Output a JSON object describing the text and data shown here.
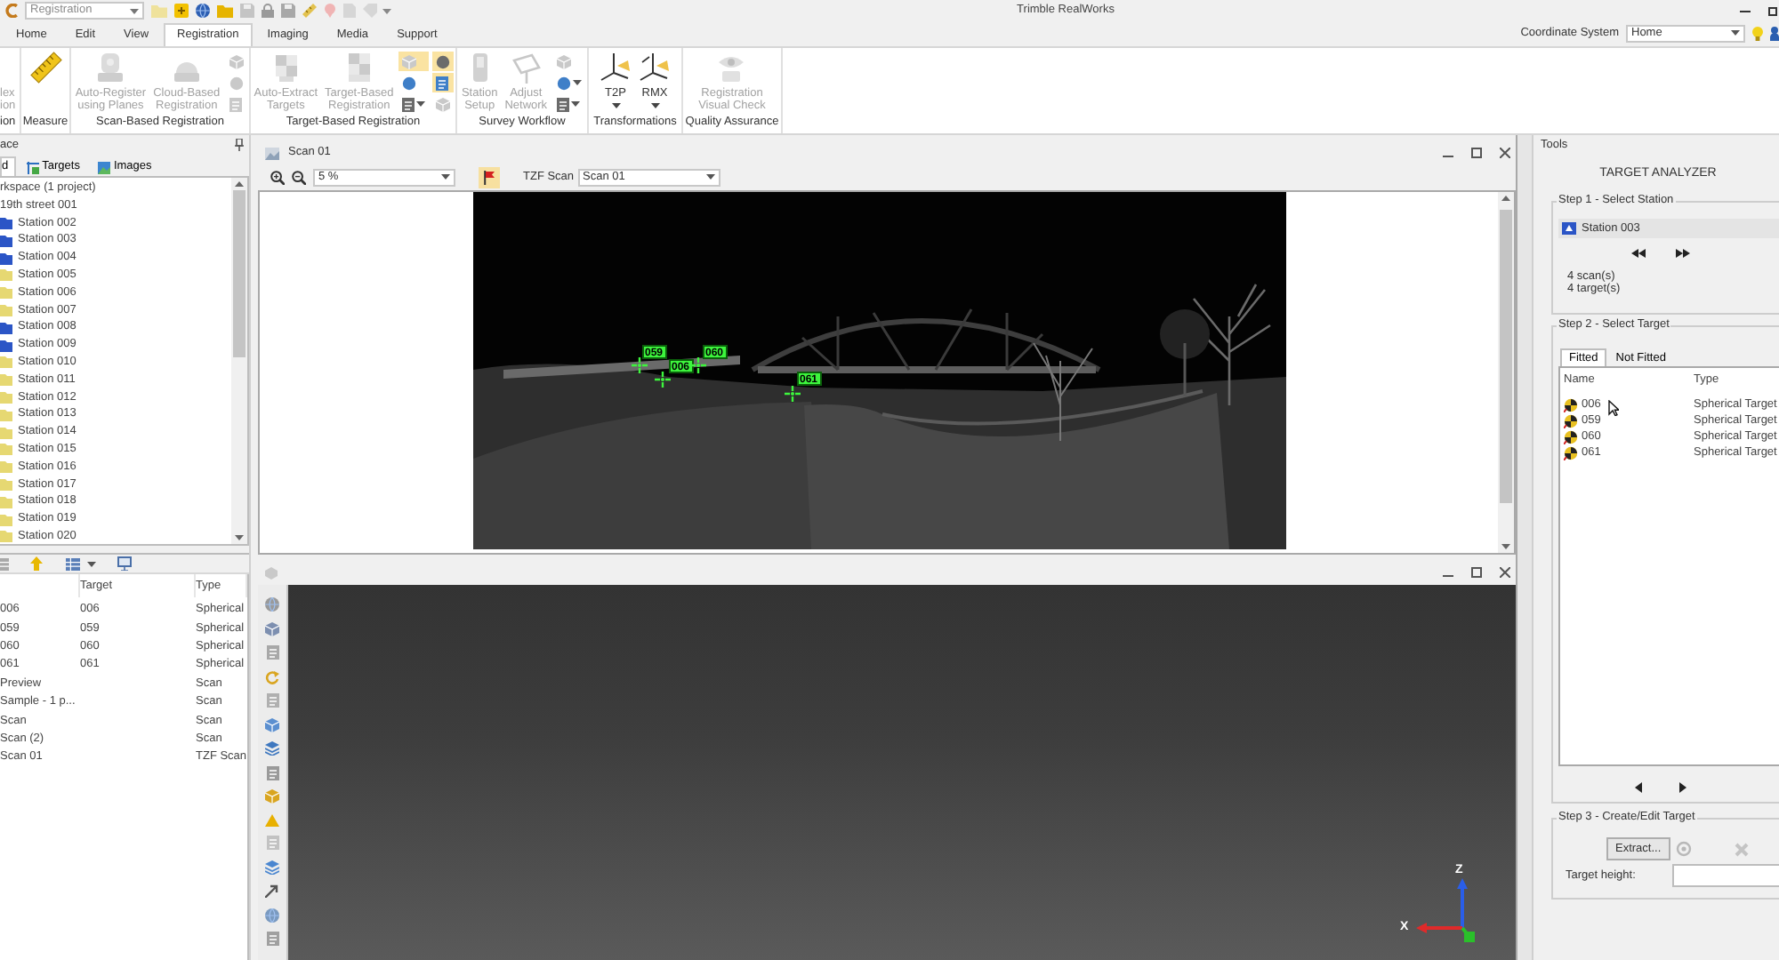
{
  "app": {
    "mode_combo": "Registration",
    "title": "Trimble RealWorks"
  },
  "ribbon_tabs": [
    {
      "label": "Home",
      "selected": false
    },
    {
      "label": "Edit",
      "selected": false
    },
    {
      "label": "View",
      "selected": false
    },
    {
      "label": "Registration",
      "selected": true
    },
    {
      "label": "Imaging",
      "selected": false
    },
    {
      "label": "Media",
      "selected": false
    },
    {
      "label": "Support",
      "selected": false
    }
  ],
  "coordinate_system": {
    "label": "Coordinate System",
    "value": "Home"
  },
  "ribbon_groups": [
    {
      "label": "ion",
      "items": [
        {
          "kind": "large",
          "lines": [
            "lex",
            "ion"
          ],
          "disabled": true,
          "menu": false
        }
      ]
    },
    {
      "label": "Measure",
      "items": [
        {
          "kind": "icon",
          "disabled": false
        }
      ]
    },
    {
      "label": "Scan-Based Registration",
      "items": [
        {
          "kind": "large",
          "lines": [
            "Auto-Register",
            "using Planes"
          ],
          "disabled": true,
          "menu": false
        },
        {
          "kind": "large",
          "lines": [
            "Cloud-Based",
            "Registration"
          ],
          "disabled": true,
          "menu": false
        },
        {
          "kind": "stack",
          "buttons": [
            {
              "on": false,
              "disabled": true,
              "menu": false
            },
            {
              "on": false,
              "disabled": true,
              "menu": false
            },
            {
              "on": false,
              "disabled": true,
              "menu": false
            }
          ]
        }
      ]
    },
    {
      "label": "Target-Based Registration",
      "items": [
        {
          "kind": "large",
          "lines": [
            "Auto-Extract",
            "Targets"
          ],
          "disabled": true,
          "menu": false
        },
        {
          "kind": "large",
          "lines": [
            "Target-Based",
            "Registration"
          ],
          "disabled": true,
          "menu": false
        },
        {
          "kind": "stack",
          "buttons": [
            {
              "on": true,
              "disabled": true,
              "menu": false
            },
            {
              "on": false,
              "disabled": false,
              "menu": false
            },
            {
              "on": false,
              "disabled": false,
              "menu": true
            }
          ]
        },
        {
          "kind": "stack",
          "buttons": [
            {
              "on": true,
              "disabled": false,
              "menu": false
            },
            {
              "on": true,
              "disabled": false,
              "menu": false
            },
            {
              "on": false,
              "disabled": true,
              "menu": false
            }
          ]
        }
      ]
    },
    {
      "label": "Survey Workflow",
      "items": [
        {
          "kind": "large",
          "lines": [
            "Station",
            "Setup"
          ],
          "disabled": true,
          "menu": false
        },
        {
          "kind": "large",
          "lines": [
            "Adjust",
            "Network"
          ],
          "disabled": true,
          "menu": false
        },
        {
          "kind": "stack",
          "buttons": [
            {
              "on": false,
              "disabled": true,
              "menu": false
            },
            {
              "on": false,
              "disabled": false,
              "menu": true
            },
            {
              "on": false,
              "disabled": false,
              "menu": true
            }
          ]
        }
      ]
    },
    {
      "label": "Transformations",
      "items": [
        {
          "kind": "large",
          "lines": [
            "T2P"
          ],
          "disabled": false,
          "menu": true
        },
        {
          "kind": "large",
          "lines": [
            "RMX"
          ],
          "disabled": false,
          "menu": true
        }
      ]
    },
    {
      "label": "Quality Assurance",
      "items": [
        {
          "kind": "large",
          "lines": [
            "Registration",
            "Visual Check"
          ],
          "disabled": true,
          "menu": false
        }
      ]
    }
  ],
  "workspace_panel": {
    "title": "ace",
    "tabs": [
      {
        "label": "d",
        "selected": true
      },
      {
        "label": "Targets",
        "selected": false
      },
      {
        "label": "Images",
        "selected": false
      }
    ],
    "tree": [
      {
        "label": "rkspace (1 project)",
        "children": [
          {
            "label": "19th street 001",
            "children": [
              {
                "label": "Station 002",
                "color": "#2b55c6"
              },
              {
                "label": "Station 003",
                "color": "#2b55c6"
              },
              {
                "label": "Station 004",
                "color": "#2b55c6"
              },
              {
                "label": "Station 005",
                "color": "#e6d872"
              },
              {
                "label": "Station 006",
                "color": "#e6d872"
              },
              {
                "label": "Station 007",
                "color": "#e6d872"
              },
              {
                "label": "Station 008",
                "color": "#2b55c6"
              },
              {
                "label": "Station 009",
                "color": "#2b55c6"
              },
              {
                "label": "Station 010",
                "color": "#e6d872"
              },
              {
                "label": "Station 011",
                "color": "#e6d872"
              },
              {
                "label": "Station 012",
                "color": "#e6d872"
              },
              {
                "label": "Station 013",
                "color": "#e6d872"
              },
              {
                "label": "Station 014",
                "color": "#e6d872"
              },
              {
                "label": "Station 015",
                "color": "#e6d872"
              },
              {
                "label": "Station 016",
                "color": "#e6d872"
              },
              {
                "label": "Station 017",
                "color": "#e6d872"
              },
              {
                "label": "Station 018",
                "color": "#e6d872"
              },
              {
                "label": "Station 019",
                "color": "#e6d872"
              },
              {
                "label": "Station 020",
                "color": "#e6d872"
              }
            ]
          }
        ]
      }
    ]
  },
  "scan_list": {
    "headers": [
      "Target",
      "Type"
    ],
    "rows": [
      {
        "column_1": "006",
        "target": "006",
        "type": "Spherical"
      },
      {
        "column_1": "059",
        "target": "059",
        "type": "Spherical"
      },
      {
        "column_1": "060",
        "target": "060",
        "type": "Spherical"
      },
      {
        "column_1": "061",
        "target": "061",
        "type": "Spherical"
      },
      {
        "column_1": "Preview",
        "type": "Scan"
      },
      {
        "column_1": "Sample - 1 p...",
        "type": "Scan"
      },
      {
        "column_1": "Scan",
        "type": "Scan"
      },
      {
        "column_1": "Scan (2)",
        "type": "Scan"
      },
      {
        "column_1": "Scan 01",
        "type": "TZF Scan"
      }
    ]
  },
  "scan_view": {
    "title": "Scan 01",
    "zoom": "5 %",
    "flag": {
      "on": true
    },
    "scan_label": "TZF Scan",
    "scan": "Scan 01",
    "targets": [
      {
        "label": "059"
      },
      {
        "label": "006"
      },
      {
        "label": "060"
      },
      {
        "label": "061"
      }
    ]
  },
  "view_3d": {
    "z_label": "Z",
    "x_label": "X"
  },
  "tools_panel": {
    "title": "Tools",
    "heading": "TARGET ANALYZER",
    "step1": {
      "legend": "Step 1 - Select Station",
      "station": "Station 003",
      "info": [
        "4 scan(s)",
        "4 target(s)"
      ]
    },
    "step2": {
      "legend": "Step 2 - Select Target",
      "tabs": [
        {
          "label": "Fitted",
          "selected": true
        },
        {
          "label": "Not Fitted",
          "selected": false
        }
      ],
      "columns": [
        "Name",
        "Type"
      ],
      "rows": [
        {
          "name": "006",
          "type": "Spherical Target"
        },
        {
          "name": "059",
          "type": "Spherical Target"
        },
        {
          "name": "060",
          "type": "Spherical Target"
        },
        {
          "name": "061",
          "type": "Spherical Target"
        }
      ]
    },
    "step3": {
      "legend": "Step 3 - Create/Edit Target",
      "extract": "Extract...",
      "height_label": "Target height:"
    }
  }
}
